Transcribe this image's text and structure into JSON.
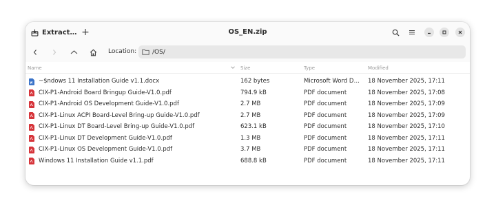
{
  "header": {
    "app_button_label": "Extract…",
    "title": "OS_EN.zip",
    "icons": {
      "app": "package-icon",
      "new_tab": "plus-icon",
      "search": "search-icon",
      "menu": "menu-icon",
      "minimize": "minimize-icon",
      "maximize": "maximize-icon",
      "close": "close-icon"
    }
  },
  "location": {
    "label": "Location:",
    "path": "/OS/"
  },
  "columns": {
    "name": "Name",
    "size": "Size",
    "type": "Type",
    "modified": "Modified"
  },
  "files": [
    {
      "name": "~$ndows 11 Installation Guide v1.1.docx",
      "size": "162 bytes",
      "type": "Microsoft Word D…",
      "modified": "18 November 2025, 17:11",
      "icon": "word-doc-icon",
      "color": "#3a73c8"
    },
    {
      "name": "CIX-P1-Android Board Bringup Guide-V1.0.pdf",
      "size": "794.9 kB",
      "type": "PDF document",
      "modified": "18 November 2025, 17:08",
      "icon": "pdf-icon",
      "color": "#d6343a"
    },
    {
      "name": "CIX-P1-Android OS Development Guide-V1.0.pdf",
      "size": "2.7 MB",
      "type": "PDF document",
      "modified": "18 November 2025, 17:09",
      "icon": "pdf-icon",
      "color": "#d6343a"
    },
    {
      "name": "CIX-P1-Linux ACPI Board-Level Bring-up Guide-V1.0.pdf",
      "size": "2.7 MB",
      "type": "PDF document",
      "modified": "18 November 2025, 17:09",
      "icon": "pdf-icon",
      "color": "#d6343a"
    },
    {
      "name": "CIX-P1-Linux DT Board-Level Bring-up Guide-V1.0.pdf",
      "size": "623.1 kB",
      "type": "PDF document",
      "modified": "18 November 2025, 17:10",
      "icon": "pdf-icon",
      "color": "#d6343a"
    },
    {
      "name": "CIX-P1-Linux DT Development Guide-V1.0.pdf",
      "size": "1.3 MB",
      "type": "PDF document",
      "modified": "18 November 2025, 17:11",
      "icon": "pdf-icon",
      "color": "#d6343a"
    },
    {
      "name": "CIX-P1-Linux OS Development Guide-V1.0.pdf",
      "size": "3.7 MB",
      "type": "PDF document",
      "modified": "18 November 2025, 17:11",
      "icon": "pdf-icon",
      "color": "#d6343a"
    },
    {
      "name": "Windows 11 Installation Guide v1.1.pdf",
      "size": "688.8 kB",
      "type": "PDF document",
      "modified": "18 November 2025, 17:11",
      "icon": "pdf-icon",
      "color": "#d6343a"
    }
  ]
}
